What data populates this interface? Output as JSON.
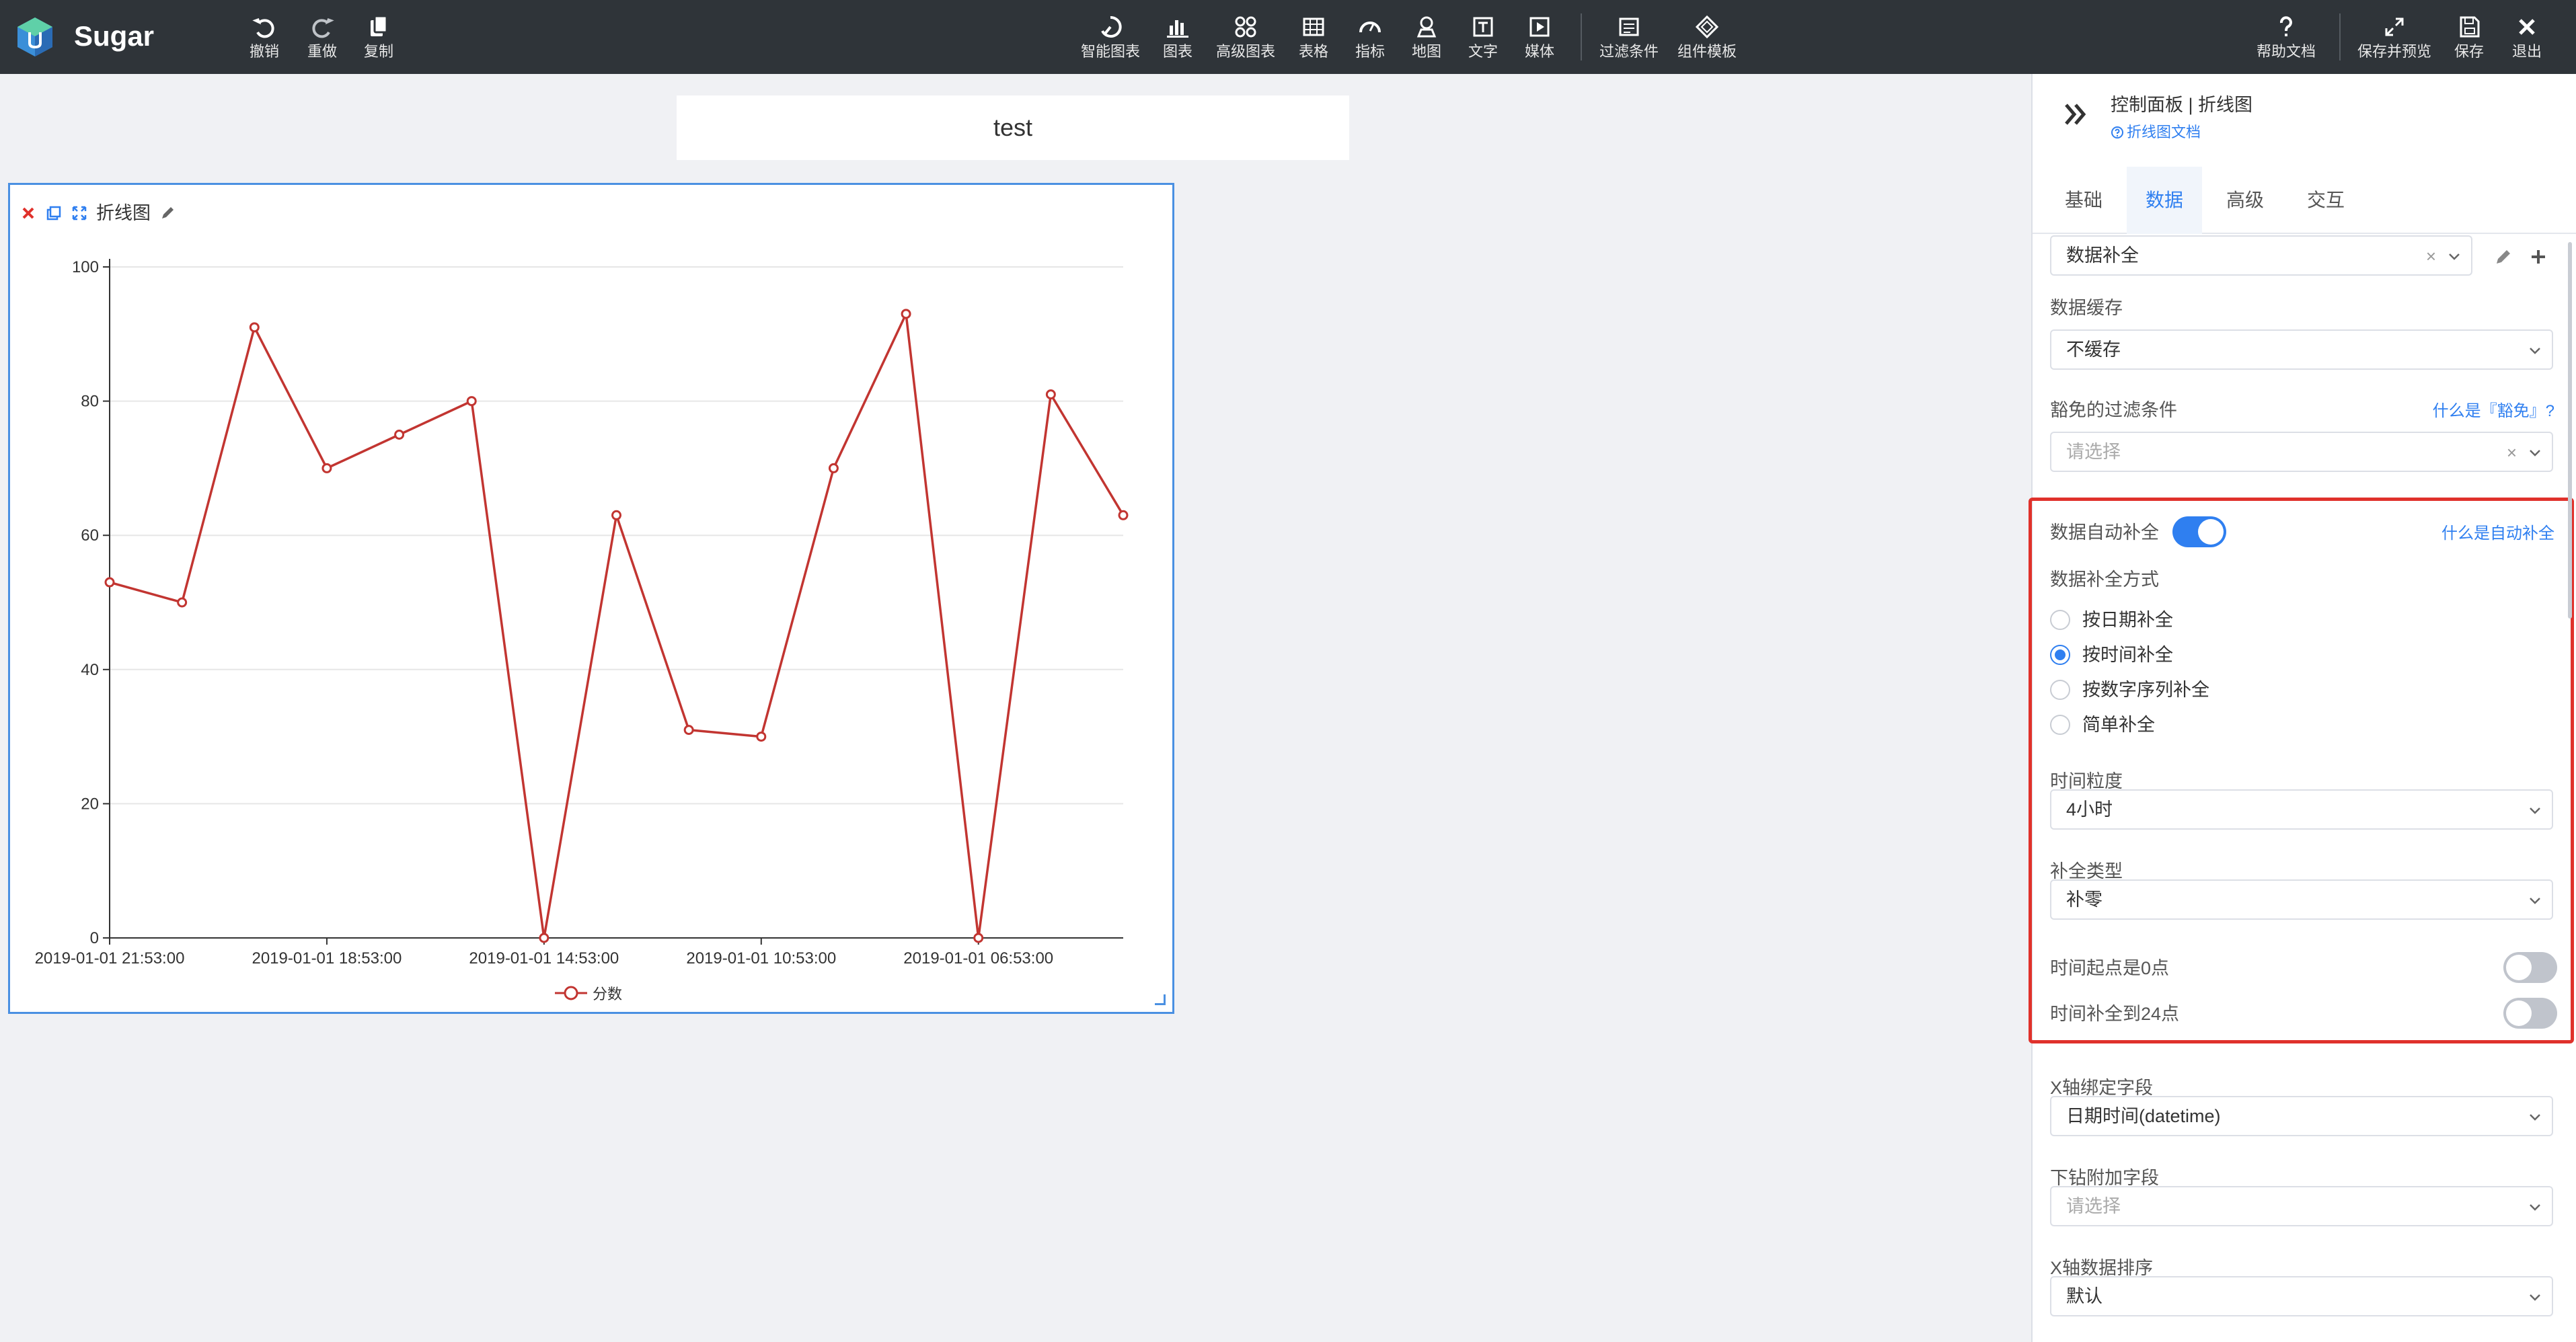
{
  "app": {
    "brand": "Sugar",
    "accent": "#2f7ff0",
    "topbar_bg": "#2f3439"
  },
  "toolbar": {
    "left": [
      {
        "label": "撤销",
        "icon": "undo-icon"
      },
      {
        "label": "重做",
        "icon": "redo-icon"
      },
      {
        "label": "复制",
        "icon": "copy-icon"
      }
    ],
    "center": [
      {
        "label": "智能图表",
        "icon": "smart-chart-icon"
      },
      {
        "label": "图表",
        "icon": "bar-chart-icon"
      },
      {
        "label": "高级图表",
        "icon": "advanced-chart-icon"
      },
      {
        "label": "表格",
        "icon": "table-icon"
      },
      {
        "label": "指标",
        "icon": "gauge-icon"
      },
      {
        "label": "地图",
        "icon": "map-pin-icon"
      },
      {
        "label": "文字",
        "icon": "text-icon"
      },
      {
        "label": "媒体",
        "icon": "media-icon"
      }
    ],
    "filters": [
      {
        "label": "过滤条件",
        "icon": "filter-icon"
      },
      {
        "label": "组件模板",
        "icon": "template-icon"
      }
    ],
    "right": [
      {
        "label": "帮助文档",
        "icon": "help-icon"
      },
      {
        "label": "保存并预览",
        "icon": "expand-icon"
      },
      {
        "label": "保存",
        "icon": "save-icon"
      },
      {
        "label": "退出",
        "icon": "close-icon"
      }
    ]
  },
  "canvas": {
    "title": "test"
  },
  "widget": {
    "title": "折线图",
    "legend": "分数"
  },
  "chart_data": {
    "type": "line",
    "title": "",
    "xlabel": "",
    "ylabel": "",
    "x_tick_labels": [
      "2019-01-01 21:53:00",
      "2019-01-01 18:53:00",
      "2019-01-01 14:53:00",
      "2019-01-01 10:53:00",
      "2019-01-01 06:53:00"
    ],
    "ylim": [
      0,
      100
    ],
    "y_ticks": [
      0,
      20,
      40,
      60,
      80,
      100
    ],
    "grid": true,
    "legend_position": "bottom-center",
    "series": [
      {
        "name": "分数",
        "color": "#c23531",
        "values": [
          53,
          50,
          91,
          70,
          75,
          80,
          0,
          63,
          31,
          30,
          70,
          93,
          0,
          81,
          63
        ]
      }
    ]
  },
  "panel": {
    "header_title": "控制面板 | 折线图",
    "doc_link": "折线图文档",
    "tabs": [
      "基础",
      "数据",
      "高级",
      "交互"
    ],
    "active_tab": "数据",
    "dataset_select": "数据补全",
    "cache_label": "数据缓存",
    "cache_value": "不缓存",
    "exempt_label": "豁免的过滤条件",
    "exempt_help": "什么是『豁免』?",
    "exempt_placeholder": "请选择",
    "auto_fill_label": "数据自动补全",
    "auto_fill_help": "什么是自动补全",
    "auto_fill_on": true,
    "fill_mode_label": "数据补全方式",
    "fill_modes": [
      "按日期补全",
      "按时间补全",
      "按数字序列补全",
      "简单补全"
    ],
    "fill_mode_selected": "按时间补全",
    "granularity_label": "时间粒度",
    "granularity_value": "4小时",
    "fill_type_label": "补全类型",
    "fill_type_value": "补零",
    "start_zero_label": "时间起点是0点",
    "start_zero_on": false,
    "fill_to_24_label": "时间补全到24点",
    "fill_to_24_on": false,
    "x_field_label": "X轴绑定字段",
    "x_field_value": "日期时间(datetime)",
    "drill_label": "下钻附加字段",
    "drill_placeholder": "请选择",
    "x_sort_label": "X轴数据排序",
    "x_sort_value": "默认",
    "highlight_color": "#e0312b"
  }
}
